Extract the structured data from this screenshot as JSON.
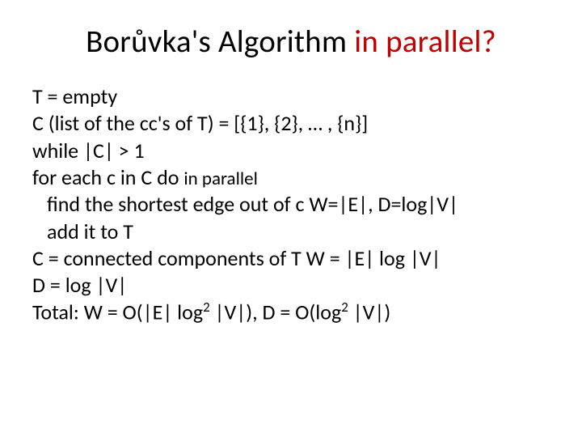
{
  "title": {
    "part1": "Borůvka's Algorithm ",
    "part2": "in parallel?"
  },
  "lines": {
    "l1": "T = empty",
    "l2": "C  (list of the cc's of T) = [{1}, {2}, … , {n}]",
    "l3": "while |C| > 1",
    "l4a": "for each c in C do ",
    "l4b": "in parallel",
    "l5": "find the shortest edge out of c    W=|E|, D=log|V|",
    "l6": "add it to T",
    "l7": "C = connected components of T    W = |E| log |V|",
    "l8": "                                                             D = log |V|",
    "l9a": "Total: W = O(|E| log",
    "l9b": " |V|), D = O(log",
    "l9c": " |V|)",
    "sup2": "2"
  }
}
